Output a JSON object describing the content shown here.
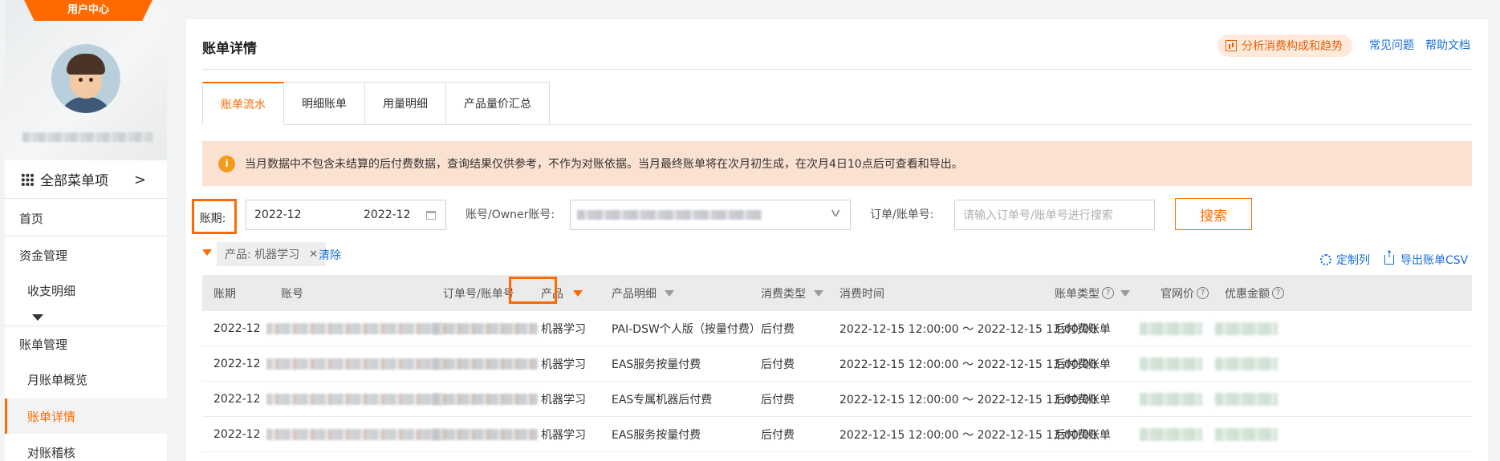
{
  "sidebar": {
    "ribbon": "用户中心",
    "all_menu": "全部菜单项",
    "items": [
      {
        "label": "首页"
      },
      {
        "label": "资金管理"
      },
      {
        "label": "收支明细"
      },
      {
        "label": "账单管理"
      },
      {
        "label": "月账单概览"
      },
      {
        "label": "账单详情"
      },
      {
        "label": "对账稽核"
      }
    ]
  },
  "header": {
    "title": "账单详情",
    "analysis_button": "分析消费构成和趋势",
    "faq_link": "常见问题",
    "help_link": "帮助文档"
  },
  "tabs": [
    "账单流水",
    "明细账单",
    "用量明细",
    "产品量价汇总"
  ],
  "notice": "当月数据中不包含未结算的后付费数据，查询结果仅供参考，不作为对账依据。当月最终账单将在次月初生成，在次月4日10点后可查看和导出。",
  "filters": {
    "period_label": "账期:",
    "date_from": "2022-12",
    "date_to": "2022-12",
    "account_label": "账号/Owner账号:",
    "order_label": "订单/账单号:",
    "order_placeholder": "请输入订单号/账单号进行搜索",
    "search_button": "搜索",
    "chip": "产品: 机器学习",
    "clear": "清除",
    "customize": "定制列",
    "export": "导出账单CSV"
  },
  "table": {
    "headers": [
      "账期",
      "账号",
      "订单号/账单号",
      "产品",
      "产品明细",
      "消费类型",
      "消费时间",
      "账单类型",
      "官网价",
      "优惠金额"
    ],
    "rows": [
      {
        "period": "2022-12",
        "product": "机器学习",
        "detail": "PAI-DSW个人版（按量付费）",
        "type": "后付费",
        "time": "2022-12-15 12:00:00 ～ 2022-12-15 13:00:00",
        "bill_type": "后付费账单"
      },
      {
        "period": "2022-12",
        "product": "机器学习",
        "detail": "EAS服务按量付费",
        "type": "后付费",
        "time": "2022-12-15 12:00:00 ～ 2022-12-15 13:00:00",
        "bill_type": "后付费账单"
      },
      {
        "period": "2022-12",
        "product": "机器学习",
        "detail": "EAS专属机器后付费",
        "type": "后付费",
        "time": "2022-12-15 12:00:00 ～ 2022-12-15 13:00:00",
        "bill_type": "后付费账单"
      },
      {
        "period": "2022-12",
        "product": "机器学习",
        "detail": "EAS服务按量付费",
        "type": "后付费",
        "time": "2022-12-15 12:00:00 ～ 2022-12-15 13:00:00",
        "bill_type": "后付费账单"
      }
    ]
  },
  "colors": {
    "accent": "#ff6a00",
    "link": "#1a6fd6",
    "notice_bg": "#fbe1d1"
  }
}
